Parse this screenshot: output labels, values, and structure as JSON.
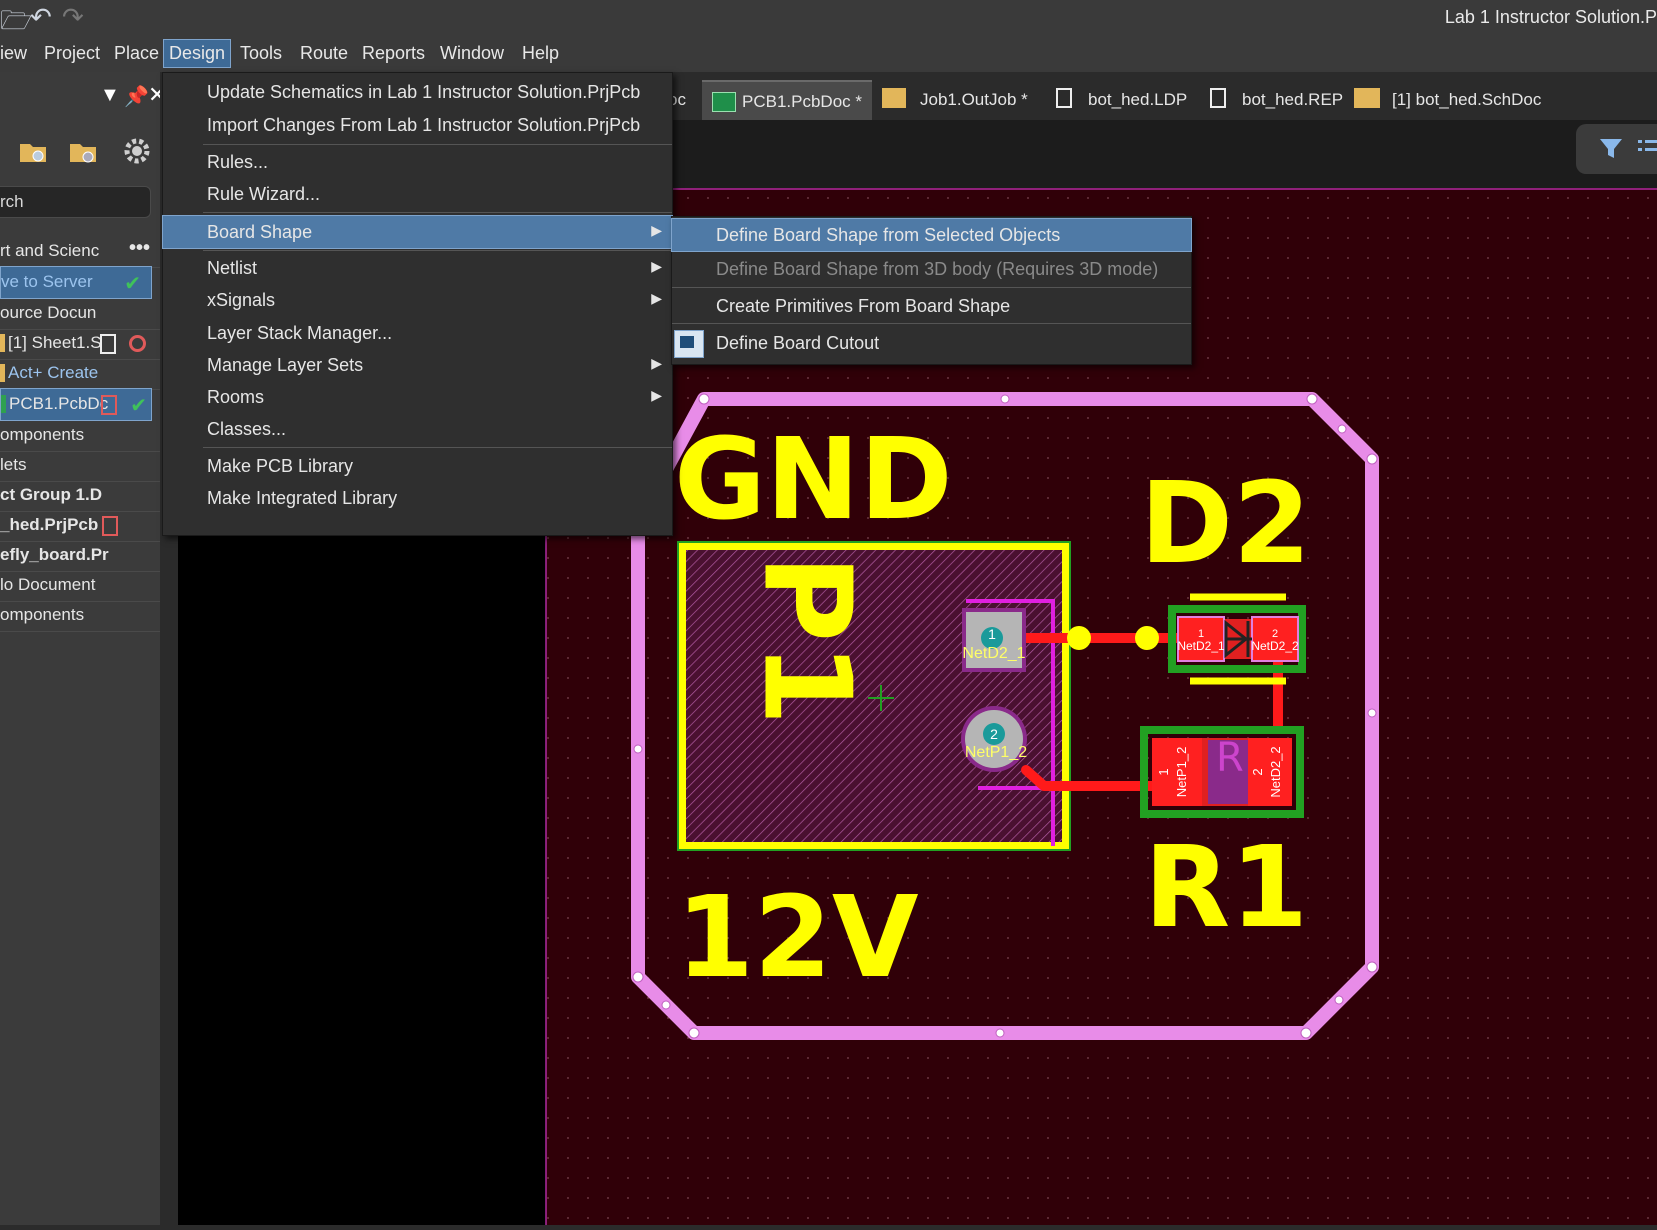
{
  "window": {
    "title": "Lab 1 Instructor Solution.P"
  },
  "menubar": [
    "iew",
    "Project",
    "Place",
    "Design",
    "Tools",
    "Route",
    "Reports",
    "Window",
    "Help"
  ],
  "design_menu": {
    "items": [
      "Update Schematics in Lab 1 Instructor Solution.PrjPcb",
      "Import Changes From Lab 1 Instructor Solution.PrjPcb",
      "Rules...",
      "Rule Wizard...",
      "Board Shape",
      "Netlist",
      "xSignals",
      "Layer Stack Manager...",
      "Manage Layer Sets",
      "Rooms",
      "Classes...",
      "Make PCB Library",
      "Make Integrated Library"
    ]
  },
  "board_shape_submenu": {
    "items": [
      "Define Board Shape from Selected Objects",
      "Define Board Shape from 3D body (Requires 3D mode)",
      "Create Primitives From Board Shape",
      "Define Board Cutout"
    ]
  },
  "panel": {
    "search_placeholder": "rch",
    "tree": [
      "rt and Scienc",
      "ve to Server",
      "ource Docun",
      "[1] Sheet1.S",
      "Act+ Create",
      "PCB1.PcbDc",
      "omponents",
      "lets",
      "ct Group 1.D",
      "_hed.PrjPcb",
      "efly_board.Pr",
      "lo Document",
      "omponents"
    ]
  },
  "doc_tabs": [
    "oc",
    "PCB1.PcbDoc *",
    "Job1.OutJob *",
    "bot_hed.LDP",
    "bot_hed.REP",
    "[1] bot_hed.SchDoc"
  ],
  "pcb": {
    "labels": {
      "gnd": "GND",
      "v12": "12V",
      "d2": "D2",
      "r1": "R1",
      "p1": "P1"
    },
    "pads": {
      "p1_1": {
        "num": "1",
        "net": "NetD2_1"
      },
      "p1_2": {
        "num": "2",
        "net": "NetP1_2"
      },
      "d2_1": {
        "num": "1",
        "net": "NetD2_1"
      },
      "d2_2": {
        "num": "2",
        "net": "NetD2_2"
      },
      "r1_1": {
        "num": "1",
        "net": "NetP1_2"
      },
      "r1_2": {
        "num": "2",
        "net": "NetD2_2"
      }
    },
    "colors": {
      "board": "#300008",
      "outline": "#e88ce8",
      "silk": "#ffff00",
      "track": "#ff1a1a",
      "comp_outline": "#22a022"
    }
  }
}
